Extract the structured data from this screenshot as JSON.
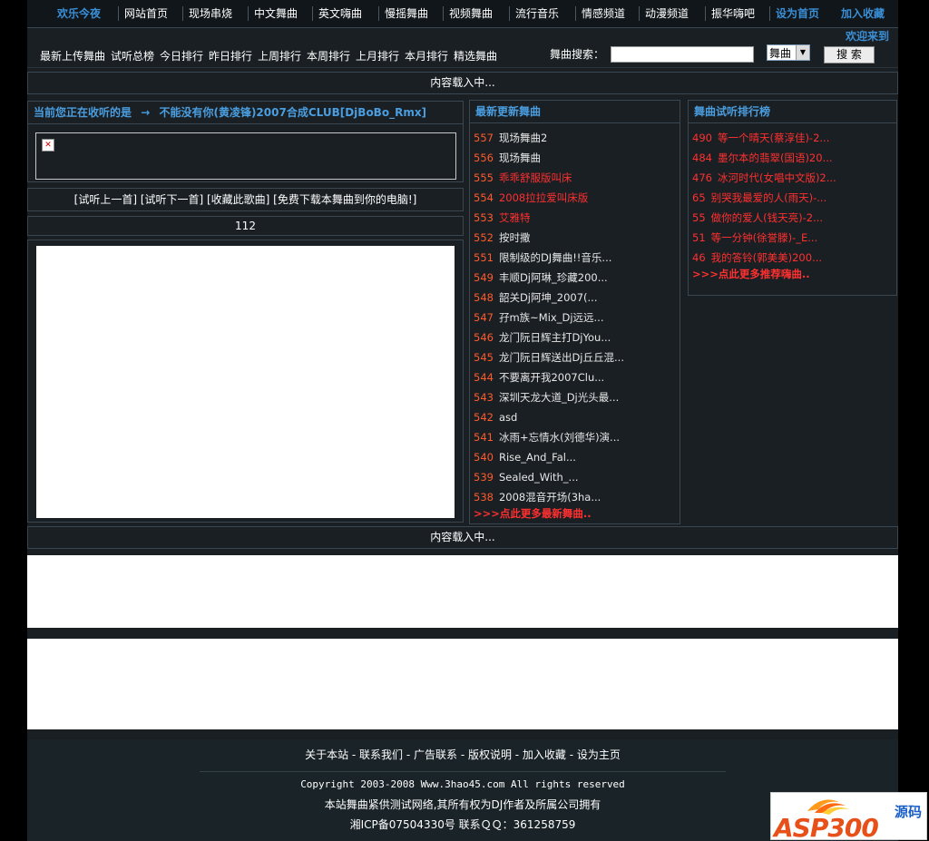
{
  "topnav": {
    "items": [
      "欢乐今夜",
      "网站首页",
      "现场串烧",
      "中文舞曲",
      "英文嗨曲",
      "慢摇舞曲",
      "视频舞曲",
      "流行音乐",
      "情感频道",
      "动漫频道",
      "振华嗨吧",
      "设为首页",
      "加入收藏"
    ]
  },
  "welcome": "欢迎来到",
  "subnav": {
    "items": [
      "最新上传舞曲",
      "试听总榜",
      "今日排行",
      "昨日排行",
      "上周排行",
      "本周排行",
      "上月排行",
      "本月排行",
      "精选舞曲"
    ],
    "search_label": "舞曲搜索：",
    "search_value": "",
    "select_value": "舞曲",
    "search_button": "搜 索"
  },
  "loading_top": "内容载入中...",
  "now_playing": {
    "label": "当前您正在收听的是",
    "arrow": "→",
    "title": "不能没有你(黄凌锋)2007合成CLUB[DjBoBo_Rmx]"
  },
  "controls": "[试听上一首] [试听下一首] [收藏此歌曲] [免费下载本舞曲到你的电脑!]",
  "count": "112",
  "latest": {
    "title": "最新更新舞曲",
    "items": [
      {
        "num": "557",
        "text": "现场舞曲2",
        "style": "white"
      },
      {
        "num": "556",
        "text": "现场舞曲",
        "style": "white"
      },
      {
        "num": "555",
        "text": "乖乖舒服版叫床",
        "style": "red"
      },
      {
        "num": "554",
        "text": "2008拉拉爱叫床版",
        "style": "red"
      },
      {
        "num": "553",
        "text": "艾雅特",
        "style": "red"
      },
      {
        "num": "552",
        "text": "按时撒",
        "style": "white"
      },
      {
        "num": "551",
        "text": "限制级的DJ舞曲!!音乐...",
        "style": "white"
      },
      {
        "num": "549",
        "text": "丰顺Dj阿琳_珍藏200...",
        "style": "white"
      },
      {
        "num": "548",
        "text": "韶关Dj阿坤_2007(...",
        "style": "white"
      },
      {
        "num": "547",
        "text": "孖m族~Mix_Dj远远...",
        "style": "white"
      },
      {
        "num": "546",
        "text": "龙门阮日辉主打DjYou...",
        "style": "white"
      },
      {
        "num": "545",
        "text": "龙门阮日辉送出Dj丘丘混...",
        "style": "white"
      },
      {
        "num": "544",
        "text": "不要离开我2007Clu...",
        "style": "white"
      },
      {
        "num": "543",
        "text": "深圳天龙大道_Dj光头最...",
        "style": "white"
      },
      {
        "num": "542",
        "text": "asd",
        "style": "white"
      },
      {
        "num": "541",
        "text": "冰雨+忘情水(刘德华)演...",
        "style": "white"
      },
      {
        "num": "540",
        "text": "Rise_And_Fal...",
        "style": "white"
      },
      {
        "num": "539",
        "text": "Sealed_With_...",
        "style": "white"
      },
      {
        "num": "538",
        "text": "2008混音开场(3ha...",
        "style": "white"
      }
    ],
    "more": ">>>点此更多最新舞曲.."
  },
  "ranking": {
    "title": "舞曲试听排行榜",
    "items": [
      {
        "num": "490",
        "text": "等一个晴天(蔡淳佳)-2..."
      },
      {
        "num": "484",
        "text": "墨尔本的翡翠(国语)20..."
      },
      {
        "num": "476",
        "text": "冰河时代(女唱中文版)2..."
      },
      {
        "num": "65",
        "text": "别哭我最爱的人(雨天)-..."
      },
      {
        "num": "55",
        "text": "做你的爱人(钱天亮)-2..."
      },
      {
        "num": "51",
        "text": "等一分钟(徐誉滕)-_E..."
      },
      {
        "num": "46",
        "text": "我的答铃(郭美美)200..."
      }
    ],
    "more": ">>>点此更多推荐嗨曲.."
  },
  "loading_bottom": "内容载入中...",
  "footer": {
    "links": "关于本站 - 联系我们 - 广告联系 - 版权说明 - 加入收藏 - 设为主页",
    "copyright": "Copyright 2003-2008 Www.3hao45.com All rights reserved",
    "disclaimer": "本站舞曲紧供测试网络,其所有权为DJ作者及所属公司拥有",
    "icp": "湘ICP备07504330号 联系ＱＱ：361258759"
  },
  "logo": {
    "text": "ASP300",
    "sub": "源码",
    "colors": {
      "asp": "#e8501a",
      "sub": "#1a5ec8"
    }
  }
}
